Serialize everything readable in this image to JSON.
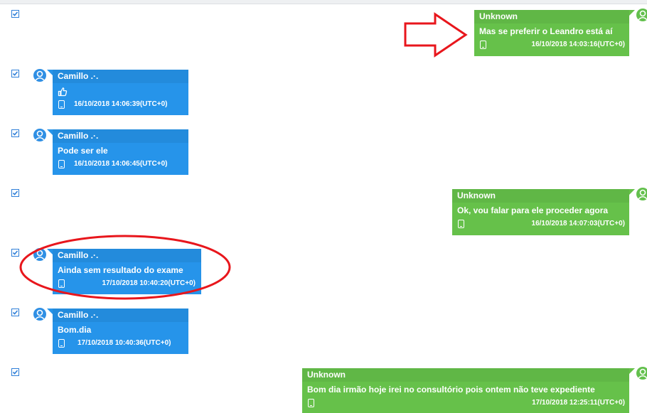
{
  "messages": [
    {
      "direction": "outgoing",
      "sender": "Unknown",
      "text": "Mas se preferir o Leandro está aí",
      "timestamp": "16/10/2018 14:03:16(UTC+0)"
    },
    {
      "direction": "incoming",
      "sender": "Camillo .·.",
      "text": "👍",
      "timestamp": "16/10/2018 14:06:39(UTC+0)"
    },
    {
      "direction": "incoming",
      "sender": "Camillo .·.",
      "text": "Pode ser ele",
      "timestamp": "16/10/2018 14:06:45(UTC+0)"
    },
    {
      "direction": "outgoing",
      "sender": "Unknown",
      "text": "Ok, vou falar para ele proceder agora",
      "timestamp": "16/10/2018 14:07:03(UTC+0)"
    },
    {
      "direction": "incoming",
      "sender": "Camillo .·.",
      "text": "Ainda sem resultado do exame",
      "timestamp": "17/10/2018 10:40:20(UTC+0)"
    },
    {
      "direction": "incoming",
      "sender": "Camillo .·.",
      "text": "Bom.dia",
      "timestamp": "17/10/2018 10:40:36(UTC+0)"
    },
    {
      "direction": "outgoing",
      "sender": "Unknown",
      "text": "Bom dia irmão hoje irei no consultório pois ontem não teve expediente",
      "timestamp": "17/10/2018 12:25:11(UTC+0)"
    }
  ],
  "colors": {
    "incoming": "#2694ea",
    "outgoing": "#66c14a",
    "annotation": "#e8161c"
  },
  "icons": {
    "select": "checkbox-icon",
    "avatar": "user-avatar-icon",
    "source": "phone-icon",
    "thumbs_up": "thumbs-up-icon"
  }
}
